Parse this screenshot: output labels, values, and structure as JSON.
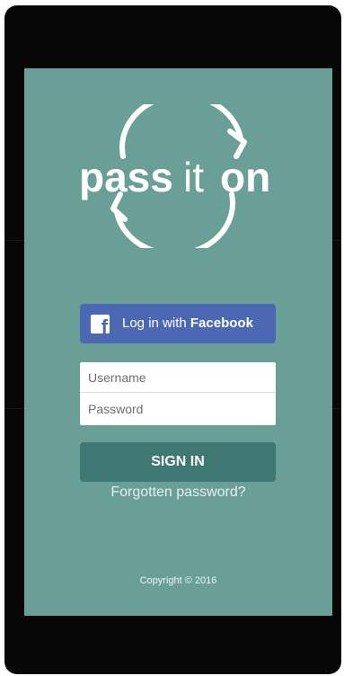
{
  "logo": {
    "word_pass": "pass",
    "word_it": "it",
    "word_on": "on"
  },
  "facebook": {
    "icon_glyph": "f",
    "label_prefix": "Log in with ",
    "label_brand": "Facebook"
  },
  "form": {
    "username_placeholder": "Username",
    "password_placeholder": "Password",
    "signin_label": "SIGN IN",
    "forgot_label": "Forgotten password?"
  },
  "footer": {
    "copyright": "Copyright © 2016"
  },
  "colors": {
    "screen_bg": "#6a9f98",
    "facebook_blue": "#4d68b3",
    "signin_bg": "#3f7873",
    "device": "#070707"
  }
}
